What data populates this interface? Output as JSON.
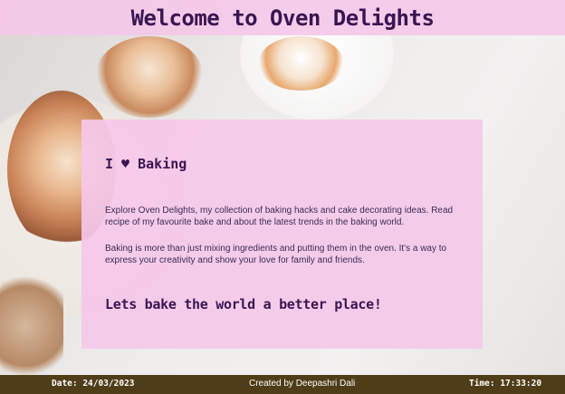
{
  "header": {
    "title": "Welcome to Oven Delights"
  },
  "card": {
    "heading": "I ♥ Baking",
    "paragraph1": "Explore Oven Delights, my collection of baking hacks and cake decorating ideas. Read recipe of my favourite bake and about the latest trends in the baking world.",
    "paragraph2": "Baking is more than just mixing ingredients and putting them in the oven. It's a way to express your creativity and show your love for family and friends.",
    "tagline": "Lets bake the world a better place!"
  },
  "footer": {
    "date": "Date: 24/03/2023",
    "credit": "Created by Deepashri Dali",
    "time": "Time: 17:33:20"
  },
  "colors": {
    "header_bg": "#f4c8e8",
    "card_bg": "#f5c8e9",
    "heading_text": "#3a1552",
    "footer_bg": "#4f3c18"
  }
}
